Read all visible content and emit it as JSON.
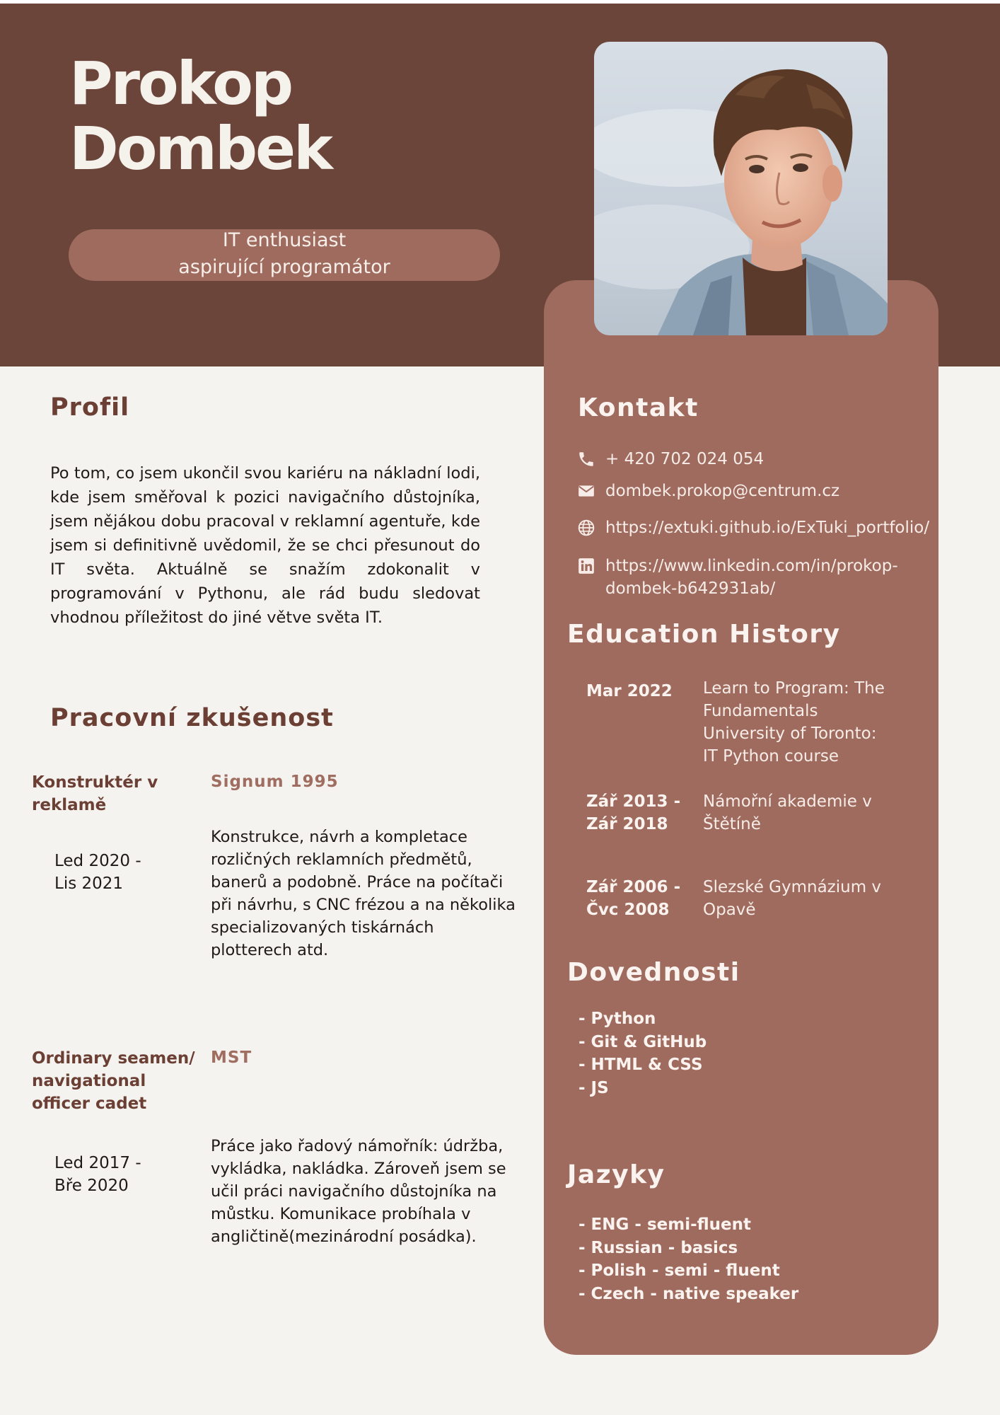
{
  "header": {
    "first_name": "Prokop",
    "last_name": "Dombek",
    "tagline_line1": "IT enthusiast",
    "tagline_line2": "aspirující programátor"
  },
  "profile": {
    "title": "Profil",
    "text": "Po tom, co jsem ukončil svou kariéru na nákladní lodi, kde jsem směřoval k pozici navigačního důstojníka, jsem nějákou dobu pracoval v reklamní agentuře, kde jsem si definitivně uvědomil, že se chci přesunout do IT světa. Aktuálně se snažím zdokonalit v programování v Pythonu, ale rád budu sledovat vhodnou příležitost do jiné větve světa IT."
  },
  "work": {
    "title": "Pracovní zkušenost",
    "jobs": [
      {
        "role": "Konstruktér v reklamě",
        "company": "Signum 1995",
        "dates_line1": "Led 2020 -",
        "dates_line2": "Lis 2021",
        "description": "Konstrukce, návrh a kompletace rozličných reklamních předmětů, banerů a podobně. Práce na počítači při návrhu, s CNC frézou a na několika specializovaných tiskárnách plotterech atd."
      },
      {
        "role": "Ordinary seamen/ navigational officer cadet",
        "company": "MST",
        "dates_line1": "Led 2017 -",
        "dates_line2": "Bře 2020",
        "description": "Práce jako řadový námořník: údržba, vykládka, nakládka. Zároveň jsem se učil práci navigačního důstojníka na můstku. Komunikace probíhala v angličtině(mezinárodní posádka)."
      }
    ]
  },
  "contact": {
    "title": "Kontakt",
    "phone": "+ 420 702 024 054",
    "email": "dombek.prokop@centrum.cz",
    "website": "https://extuki.github.io/ExTuki_portfolio/",
    "linkedin_line1": "https://www.linkedin.com/in/prokop-",
    "linkedin_line2": "dombek-b642931ab/"
  },
  "education": {
    "title": "Education History",
    "items": [
      {
        "date_line1": "Mar 2022",
        "date_line2": "",
        "desc_lines": [
          "Learn to Program: The Fundamentals",
          "University of Toronto:",
          "IT Python course"
        ]
      },
      {
        "date_line1": "Zář 2013 -",
        "date_line2": "Zář 2018",
        "desc_lines": [
          "Námořní akademie v Štětíně"
        ]
      },
      {
        "date_line1": "Zář 2006 -",
        "date_line2": "Čvc 2008",
        "desc_lines": [
          "Slezské Gymnázium v Opavě"
        ]
      }
    ]
  },
  "skills": {
    "title": "Dovednosti",
    "items": [
      "- Python",
      "- Git & GitHub",
      "- HTML & CSS",
      "- JS"
    ]
  },
  "languages": {
    "title": "Jazyky",
    "items": [
      "- ENG - semi-fluent",
      "- Russian - basics",
      "- Polish - semi - fluent",
      "- Czech - native speaker"
    ]
  },
  "colors": {
    "header_bg": "#6b443a",
    "sidebar_bg": "#9f6b5e",
    "page_bg": "#f5f3ef",
    "accent_title": "#6b3f34",
    "accent_company": "#a06d61"
  }
}
